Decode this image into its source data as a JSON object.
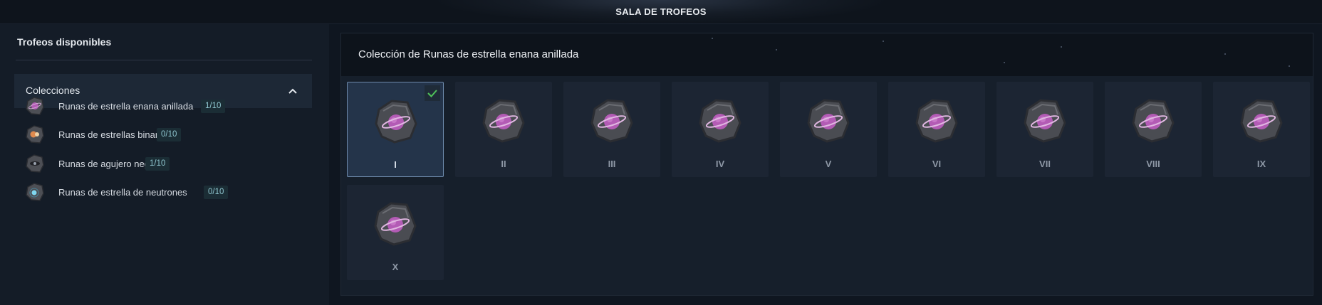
{
  "topbar": {
    "title": "SALA DE TROFEOS"
  },
  "sidebar": {
    "heading": "Trofeos disponibles",
    "accordion": {
      "label": "Colecciones"
    },
    "collections": [
      {
        "name": "Runas de estrella enana anillada",
        "count": "1/10",
        "icon": "ringed-dwarf-star-rune-icon"
      },
      {
        "name": "Runas de estrellas binarias",
        "count": "0/10",
        "icon": "binary-stars-rune-icon"
      },
      {
        "name": "Runas de agujero negro",
        "count": "1/10",
        "icon": "black-hole-rune-icon"
      },
      {
        "name": "Runas de estrella de neutrones",
        "count": "0/10",
        "icon": "neutron-star-rune-icon"
      }
    ]
  },
  "main": {
    "title": "Colección de Runas de estrella enana anillada",
    "runes": [
      {
        "numeral": "I",
        "collected": true
      },
      {
        "numeral": "II",
        "collected": false
      },
      {
        "numeral": "III",
        "collected": false
      },
      {
        "numeral": "IV",
        "collected": false
      },
      {
        "numeral": "V",
        "collected": false
      },
      {
        "numeral": "VI",
        "collected": false
      },
      {
        "numeral": "VII",
        "collected": false
      },
      {
        "numeral": "VIII",
        "collected": false
      },
      {
        "numeral": "IX",
        "collected": false
      },
      {
        "numeral": "X",
        "collected": false
      }
    ]
  },
  "colors": {
    "background": "#0f1620",
    "panel": "#141c27",
    "badge_text": "#8fc6cf",
    "checkmark": "#4fc25a",
    "planet": "#b35bb5"
  }
}
